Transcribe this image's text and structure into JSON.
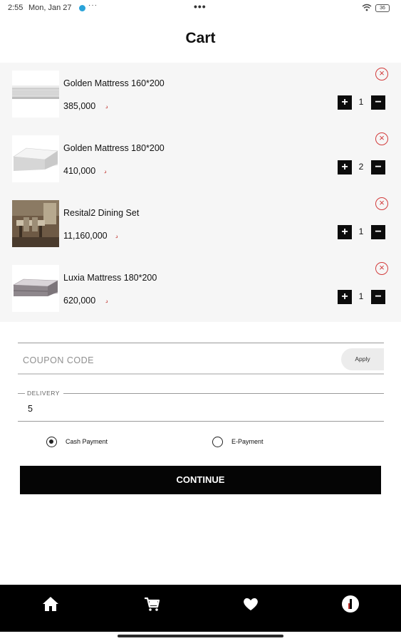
{
  "status_bar": {
    "time": "2:55",
    "date": "Mon, Jan 27",
    "more": "···",
    "center_dots": "•••",
    "battery": "36"
  },
  "page": {
    "title": "Cart"
  },
  "cart": {
    "items": [
      {
        "name": "Golden Mattress 160*200",
        "price": "385,000",
        "currency": "د",
        "quantity": "1",
        "plus": "+",
        "minus": "−",
        "remove": "×",
        "thumbnail": "white-quilted-mattress"
      },
      {
        "name": "Golden Mattress 180*200",
        "price": "410,000",
        "currency": "د",
        "quantity": "2",
        "plus": "+",
        "minus": "−",
        "remove": "×",
        "thumbnail": "white-mattress"
      },
      {
        "name": "Resital2  Dining Set",
        "price": "11,160,000",
        "currency": "د",
        "quantity": "1",
        "plus": "+",
        "minus": "−",
        "remove": "×",
        "thumbnail": "dining-set-photo"
      },
      {
        "name": "Luxia  Mattress 180*200",
        "price": "620,000",
        "currency": "د",
        "quantity": "1",
        "plus": "+",
        "minus": "−",
        "remove": "×",
        "thumbnail": "grey-pillowtop-mattress"
      }
    ]
  },
  "coupon": {
    "placeholder": "COUPON CODE",
    "apply_label": "Apply"
  },
  "delivery": {
    "label": "DELIVERY",
    "value": "5"
  },
  "payment": {
    "options": [
      {
        "label": "Cash Payment",
        "selected": true
      },
      {
        "label": "E-Payment",
        "selected": false
      }
    ]
  },
  "continue_label": "CONTINUE",
  "bottom_nav": {
    "items": [
      "home-icon",
      "cart-icon",
      "heart-icon",
      "profile-icon"
    ]
  },
  "colors": {
    "accent": "#000000",
    "remove": "#d23b3b",
    "currency": "#c0302b",
    "list_bg": "#f6f6f6"
  }
}
